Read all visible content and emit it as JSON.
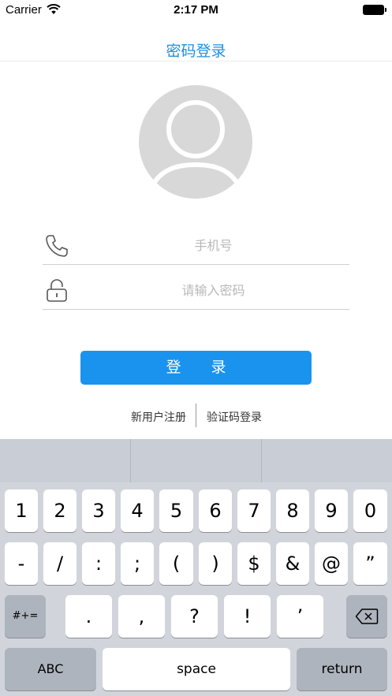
{
  "status_bar": {
    "carrier": "Carrier",
    "time": "2:17 PM"
  },
  "nav": {
    "title": "密码登录"
  },
  "form": {
    "phone_placeholder": "手机号",
    "password_placeholder": "请输入密码",
    "login_label": "登 录"
  },
  "links": {
    "register": "新用户注册",
    "sms_login": "验证码登录"
  },
  "keyboard": {
    "row1": [
      "1",
      "2",
      "3",
      "4",
      "5",
      "6",
      "7",
      "8",
      "9",
      "0"
    ],
    "row2": [
      "-",
      "/",
      ":",
      ";",
      "(",
      ")",
      "$",
      "&",
      "@",
      "”"
    ],
    "row3_mode": "#+=",
    "row3": [
      ".",
      ",",
      "?",
      "!",
      "’"
    ],
    "abc": "ABC",
    "space": "space",
    "return": "return",
    "delete_icon": "backspace-icon"
  },
  "colors": {
    "accent": "#1a93ee",
    "title": "#1d8fe0",
    "keyboard_bg": "#d1d5db"
  }
}
